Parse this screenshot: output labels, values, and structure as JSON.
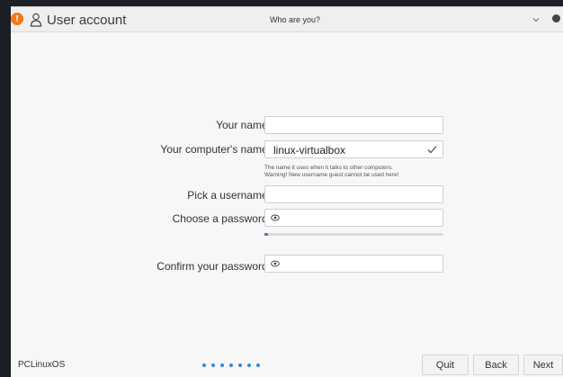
{
  "window": {
    "title": "User account",
    "subtitle": "Who are you?",
    "app_icon_glyph": "!",
    "accent_color": "#f07a1a"
  },
  "form": {
    "name_label": "Your name:",
    "name_value": "",
    "computer_label": "Your computer's name:",
    "computer_value": "linux-virtualbox",
    "hint_line1": "The name it uses when it talks to other computers.",
    "hint_line2": "Warning! New username guest cannot be used here!",
    "username_label": "Pick a username:",
    "username_value": "",
    "password_label": "Choose a password:",
    "password_value": "",
    "password_strength": 0.02,
    "confirm_label": "Confirm your password:",
    "confirm_value": ""
  },
  "footer": {
    "brand": "PCLinuxOS",
    "step_dot_count": 7,
    "dot_color": "#3e86d6",
    "quit_label": "Quit",
    "back_label": "Back",
    "next_label": "Next"
  },
  "icons": {
    "user": "user-icon",
    "chevron": "chevron-down-icon",
    "close": "close-icon",
    "check": "check-icon",
    "eye": "eye-icon"
  }
}
